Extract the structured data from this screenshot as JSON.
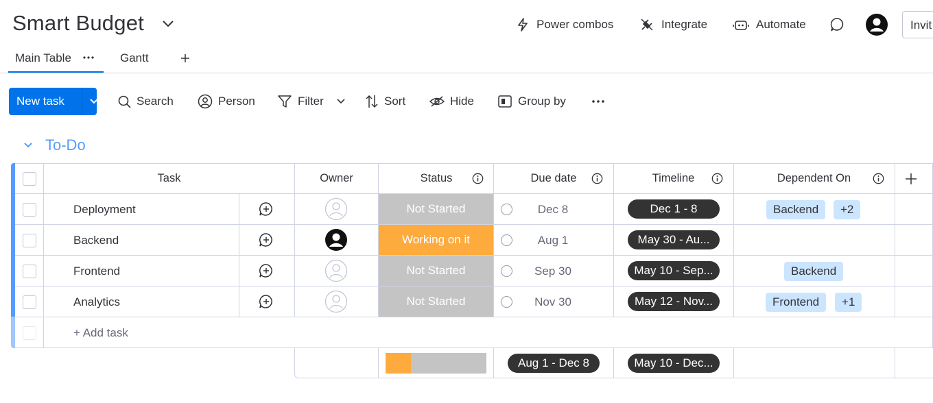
{
  "header": {
    "board_title": "Smart Budget",
    "power_combos": "Power combos",
    "integrate": "Integrate",
    "automate": "Automate",
    "invite": "Invit"
  },
  "tabs": [
    {
      "label": "Main Table",
      "active": true
    },
    {
      "label": "Gantt",
      "active": false
    }
  ],
  "toolbar": {
    "new_task": "New task",
    "search": "Search",
    "person": "Person",
    "filter": "Filter",
    "sort": "Sort",
    "hide": "Hide",
    "group_by": "Group by"
  },
  "group": {
    "title": "To-Do",
    "color": "#579bfc"
  },
  "columns": {
    "task": "Task",
    "owner": "Owner",
    "status": "Status",
    "due_date": "Due date",
    "timeline": "Timeline",
    "dependent_on": "Dependent On"
  },
  "rows": [
    {
      "task": "Deployment",
      "owner": "empty",
      "status": "Not Started",
      "status_color": "#c4c4c4",
      "due": "Dec 8",
      "timeline": "Dec 1 - 8",
      "deps": [
        "Backend",
        "+2"
      ]
    },
    {
      "task": "Backend",
      "owner": "assigned",
      "status": "Working on it",
      "status_color": "#fdab3d",
      "due": "Aug 1",
      "timeline": "May 30 - Au...",
      "deps": []
    },
    {
      "task": "Frontend",
      "owner": "empty",
      "status": "Not Started",
      "status_color": "#c4c4c4",
      "due": "Sep 30",
      "timeline": "May 10 - Sep...",
      "deps": [
        "Backend"
      ]
    },
    {
      "task": "Analytics",
      "owner": "empty",
      "status": "Not Started",
      "status_color": "#c4c4c4",
      "due": "Nov 30",
      "timeline": "May 12 - Nov...",
      "deps": [
        "Frontend",
        "+1"
      ]
    }
  ],
  "add_task": "+ Add task",
  "summary": {
    "status_working_fraction": 0.25,
    "due_range": "Aug 1 - Dec 8",
    "timeline_range": "May 10 - Dec..."
  }
}
